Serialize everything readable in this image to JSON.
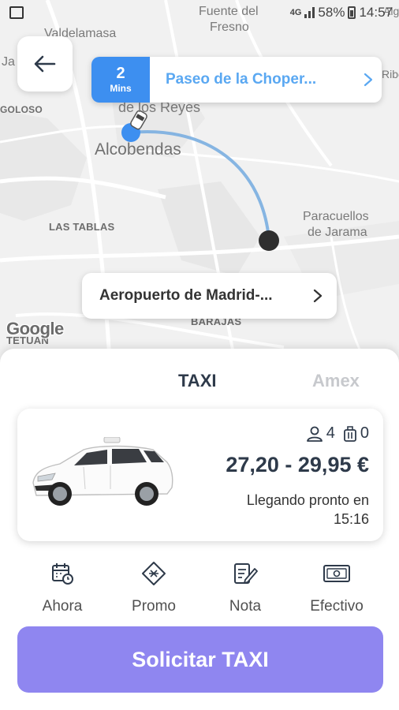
{
  "statusbar": {
    "network": "4G",
    "battery": "58%",
    "time": "14:57"
  },
  "map": {
    "labels": {
      "fuente": "Fuente del",
      "fresno": "Fresno",
      "valdelamasa": "Valdelamasa",
      "ja": "Ja",
      "golo": "GOLOSO",
      "reyes": "de los Reyes",
      "alcobendas": "Alcobendas",
      "las_tablas": "LAS TABLAS",
      "paracuellos": "Paracuellos",
      "de_jarama": "de Jarama",
      "barajas": "BARAJAS",
      "tetuan": "TETUAN",
      "algete": "Algete",
      "ribe": "Ribe"
    },
    "google": "Google"
  },
  "route": {
    "eta_value": "2",
    "eta_unit": "Mins",
    "destination": "Paseo de la Choper...",
    "origin": "Aeropuerto de Madrid-..."
  },
  "tabs": {
    "taxi": "TAXI",
    "amex": "Amex"
  },
  "vehicle": {
    "passengers": "4",
    "luggage": "0",
    "price": "27,20 - 29,95 €",
    "arriving": "Llegando pronto en 15:16"
  },
  "options": {
    "now": "Ahora",
    "promo": "Promo",
    "note": "Nota",
    "cash": "Efectivo"
  },
  "cta": "Solicitar TAXI",
  "colors": {
    "eta_bg": "#3d8ff0",
    "dest_text": "#5aa8f2",
    "cta_bg": "#8f86f0",
    "dark_text": "#2e3a4a"
  }
}
